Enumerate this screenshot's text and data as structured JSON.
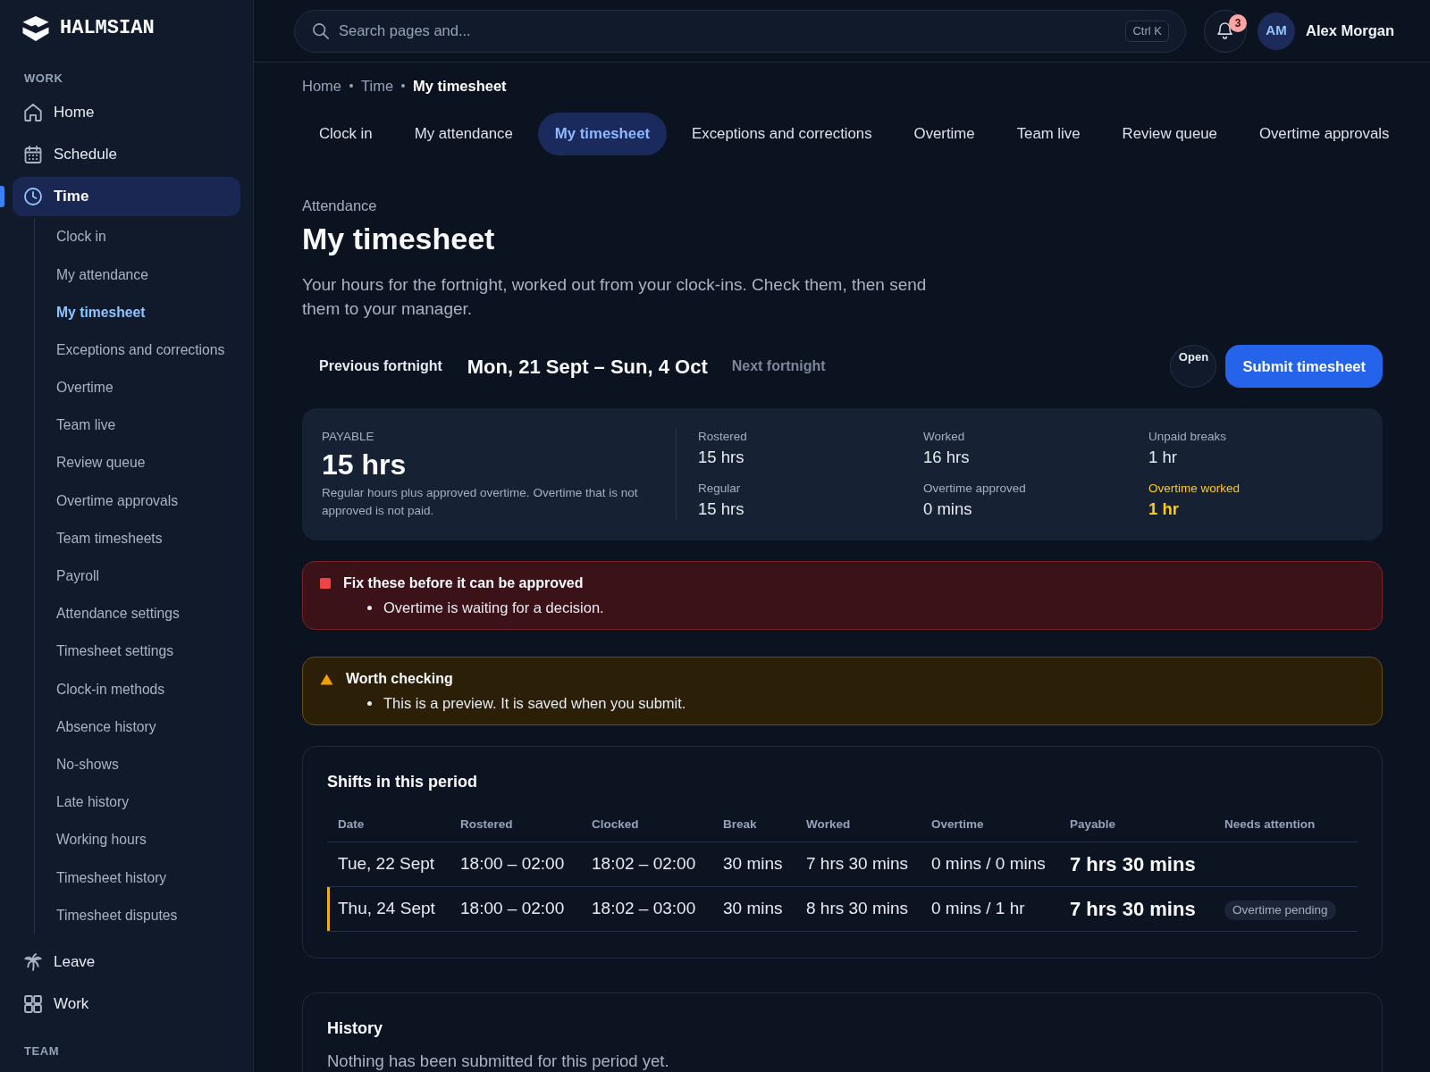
{
  "brand": {
    "name": "HALMSIAN"
  },
  "sidebar": {
    "sections": [
      {
        "label": "WORK",
        "items": [
          {
            "label": "Home",
            "selected": false
          },
          {
            "label": "Schedule",
            "selected": false
          },
          {
            "label": "Time",
            "selected": true,
            "children": [
              {
                "label": "Clock in",
                "selected": false
              },
              {
                "label": "My attendance",
                "selected": false
              },
              {
                "label": "My timesheet",
                "selected": true
              },
              {
                "label": "Exceptions and corrections",
                "selected": false
              },
              {
                "label": "Overtime",
                "selected": false
              },
              {
                "label": "Team live",
                "selected": false
              },
              {
                "label": "Review queue",
                "selected": false
              },
              {
                "label": "Overtime approvals",
                "selected": false
              },
              {
                "label": "Team timesheets",
                "selected": false
              },
              {
                "label": "Payroll",
                "selected": false
              },
              {
                "label": "Attendance settings",
                "selected": false
              },
              {
                "label": "Timesheet settings",
                "selected": false
              },
              {
                "label": "Clock-in methods",
                "selected": false
              },
              {
                "label": "Absence history",
                "selected": false
              },
              {
                "label": "No-shows",
                "selected": false
              },
              {
                "label": "Late history",
                "selected": false
              },
              {
                "label": "Working hours",
                "selected": false
              },
              {
                "label": "Timesheet history",
                "selected": false
              },
              {
                "label": "Timesheet disputes",
                "selected": false
              }
            ]
          },
          {
            "label": "Leave",
            "selected": false
          },
          {
            "label": "Work",
            "selected": false
          }
        ]
      },
      {
        "label": "TEAM"
      }
    ]
  },
  "header": {
    "search": {
      "placeholder": "Search pages and...",
      "shortcut": "Ctrl K"
    },
    "notifications": {
      "count": "3"
    },
    "user": {
      "initials": "AM",
      "name": "Alex Morgan"
    }
  },
  "breadcrumb": [
    "Home",
    "Time",
    "My timesheet"
  ],
  "tabs": [
    {
      "label": "Clock in",
      "selected": false
    },
    {
      "label": "My attendance",
      "selected": false
    },
    {
      "label": "My timesheet",
      "selected": true
    },
    {
      "label": "Exceptions and corrections",
      "selected": false
    },
    {
      "label": "Overtime",
      "selected": false
    },
    {
      "label": "Team live",
      "selected": false
    },
    {
      "label": "Review queue",
      "selected": false
    },
    {
      "label": "Overtime approvals",
      "selected": false
    }
  ],
  "page": {
    "eyebrow": "Attendance",
    "title": "My timesheet",
    "description": "Your hours for the fortnight, worked out from your clock-ins. Check them, then send them to your manager."
  },
  "period": {
    "previous": {
      "label": "Previous fortnight",
      "disabled": false
    },
    "range": "Mon, 21 Sept – Sun, 4 Oct",
    "next": {
      "label": "Next fortnight",
      "disabled": true
    },
    "status": "Open",
    "submit": "Submit timesheet"
  },
  "summary": {
    "payable": {
      "label": "PAYABLE",
      "value": "15 hrs",
      "note": "Regular hours plus approved overtime. Overtime that is not approved is not paid."
    },
    "stats": [
      {
        "label": "Rostered",
        "value": "15 hrs",
        "flagged": false
      },
      {
        "label": "Worked",
        "value": "16 hrs",
        "flagged": false
      },
      {
        "label": "Unpaid breaks",
        "value": "1 hr",
        "flagged": false
      },
      {
        "label": "Regular",
        "value": "15 hrs",
        "flagged": false
      },
      {
        "label": "Overtime approved",
        "value": "0 mins",
        "flagged": false
      },
      {
        "label": "Overtime worked",
        "value": "1 hr",
        "flagged": true
      }
    ]
  },
  "alerts": [
    {
      "kind": "error",
      "title": "Fix these before it can be approved",
      "items": [
        "Overtime is waiting for a decision."
      ]
    },
    {
      "kind": "warning",
      "title": "Worth checking",
      "items": [
        "This is a preview. It is saved when you submit."
      ]
    }
  ],
  "shifts": {
    "title": "Shifts in this period",
    "columns": [
      {
        "label": "Date",
        "kind": "text"
      },
      {
        "label": "Rostered",
        "kind": "text"
      },
      {
        "label": "Clocked",
        "kind": "text"
      },
      {
        "label": "Break",
        "kind": "text"
      },
      {
        "label": "Worked",
        "kind": "text"
      },
      {
        "label": "Overtime",
        "kind": "text"
      },
      {
        "label": "Payable",
        "kind": "total"
      },
      {
        "label": "Needs attention",
        "kind": "tag"
      }
    ],
    "rows": [
      {
        "cells": [
          "Tue, 22 Sept",
          "18:00 – 02:00",
          "18:02 – 02:00",
          "30 mins",
          "7 hrs 30 mins",
          "0 mins / 0 mins",
          "7 hrs 30 mins"
        ]
      },
      {
        "cells": [
          "Thu, 24 Sept",
          "18:00 – 02:00",
          "18:02 – 03:00",
          "30 mins",
          "8 hrs 30 mins",
          "0 mins / 1 hr",
          "7 hrs 30 mins"
        ],
        "attention": "Overtime pending"
      }
    ]
  },
  "history": {
    "title": "History",
    "message": "Nothing has been submitted for this period yet."
  }
}
